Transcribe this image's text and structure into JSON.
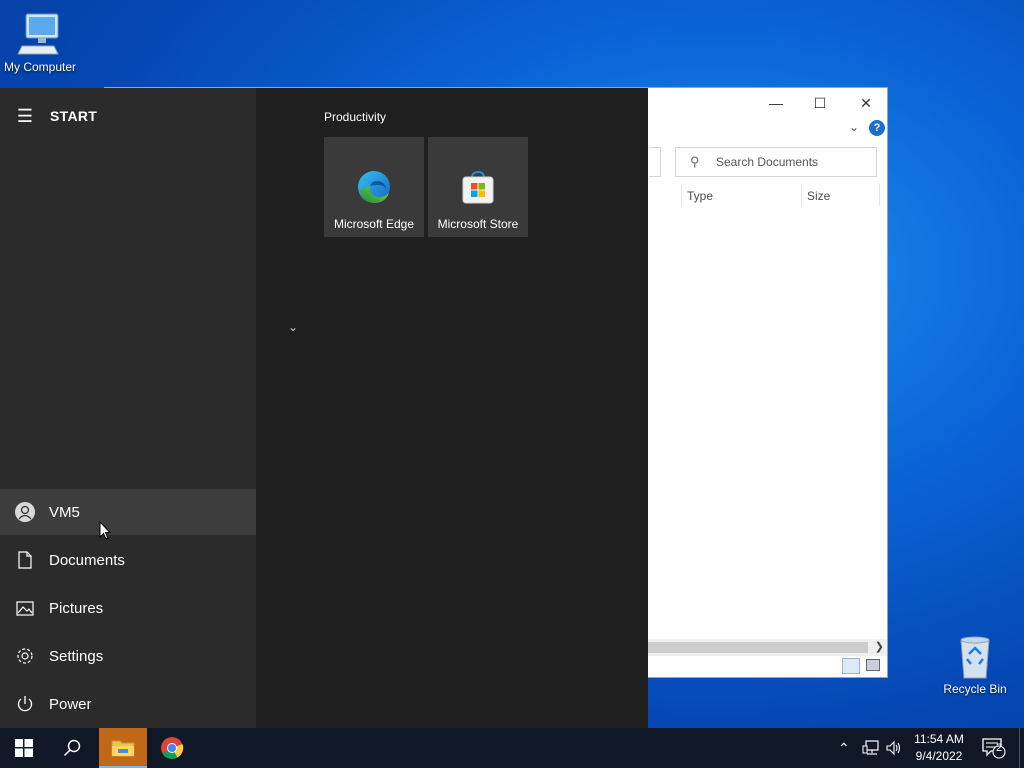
{
  "desktop": {
    "my_computer_label": "My Computer",
    "recycle_bin_label": "Recycle Bin"
  },
  "explorer": {
    "search_placeholder": "Search Documents",
    "columns": [
      "Type",
      "Size"
    ],
    "help_symbol": "?"
  },
  "start_menu": {
    "title": "START",
    "group_label": "Productivity",
    "tiles": [
      {
        "label": "Microsoft Edge",
        "icon": "edge-icon"
      },
      {
        "label": "Microsoft Store",
        "icon": "store-icon"
      }
    ],
    "nav": [
      {
        "label": "VM5",
        "icon": "user-icon"
      },
      {
        "label": "Documents",
        "icon": "document-icon"
      },
      {
        "label": "Pictures",
        "icon": "pictures-icon"
      },
      {
        "label": "Settings",
        "icon": "gear-icon"
      },
      {
        "label": "Power",
        "icon": "power-icon"
      }
    ]
  },
  "taskbar": {
    "clock_time": "11:54 AM",
    "clock_date": "9/4/2022",
    "notification_count": "2",
    "colors": {
      "active_app": "#c06818",
      "bar": "#101828"
    }
  }
}
